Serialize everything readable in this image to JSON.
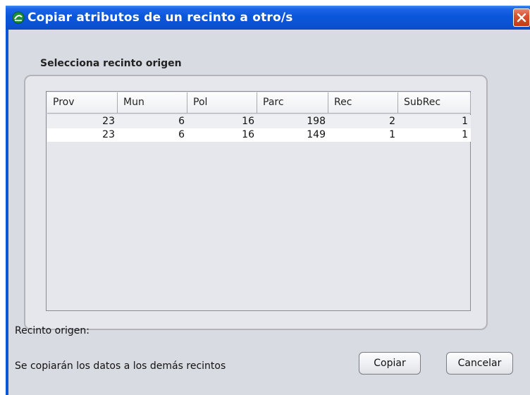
{
  "window": {
    "title": "Copiar atributos de un recinto a otro/s"
  },
  "origin_group": {
    "label": "Selecciona recinto origen"
  },
  "table": {
    "columns": [
      "Prov",
      "Mun",
      "Pol",
      "Parc",
      "Rec",
      "SubRec"
    ],
    "rows": [
      [
        "23",
        "6",
        "16",
        "198",
        "2",
        "1"
      ],
      [
        "23",
        "6",
        "16",
        "149",
        "1",
        "1"
      ]
    ]
  },
  "footer": {
    "origin_label": "Recinto origen:",
    "info_text": "Se copiarán los datos a los demás recintos",
    "copy_label": "Copiar",
    "cancel_label": "Cancelar"
  },
  "colors": {
    "title_bar": "#0a56da",
    "close_button": "#d6532f",
    "window_bg": "#d9dbe2"
  },
  "icons": {
    "app": "green-app-icon",
    "close": "close-icon"
  }
}
